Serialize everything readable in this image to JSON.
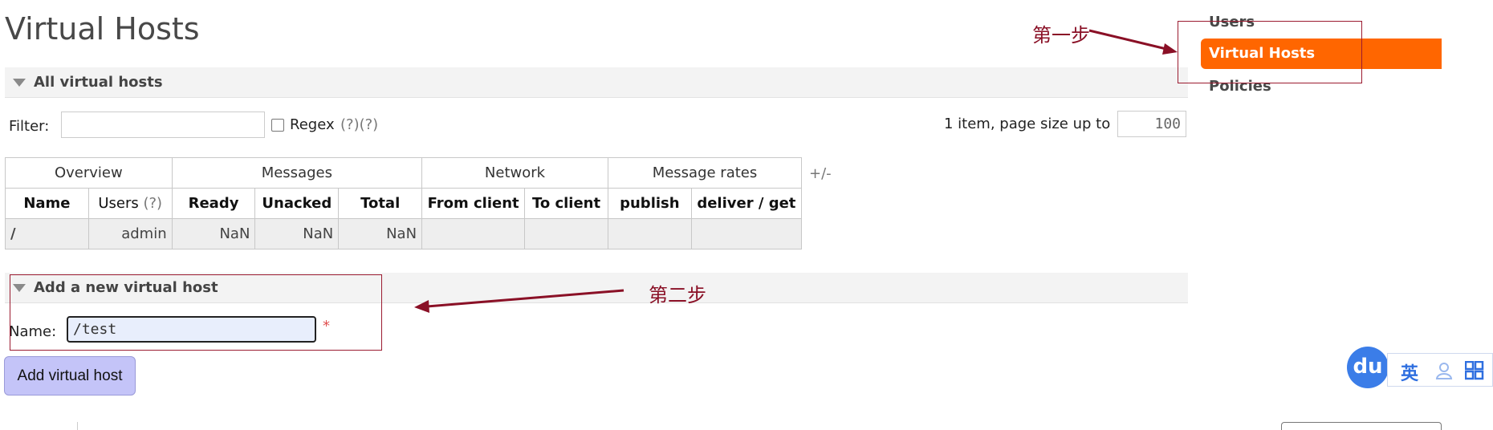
{
  "page": {
    "title": "Virtual Hosts"
  },
  "all_section": {
    "title": "All virtual hosts"
  },
  "filter": {
    "label": "Filter:",
    "value": "",
    "regex_label": "Regex",
    "regex_help": "(?)(?)",
    "items_text": "1 item, page size up to",
    "page_size": "100"
  },
  "table": {
    "groups": [
      "Overview",
      "Messages",
      "Network",
      "Message rates"
    ],
    "toggle": "+/-",
    "columns": {
      "name": "Name",
      "users": "Users",
      "users_help": "(?)",
      "ready": "Ready",
      "unacked": "Unacked",
      "total": "Total",
      "from_client": "From client",
      "to_client": "To client",
      "publish": "publish",
      "deliver_get": "deliver / get"
    },
    "rows": [
      {
        "name": "/",
        "users": "admin",
        "ready": "NaN",
        "unacked": "NaN",
        "total": "NaN",
        "from_client": "",
        "to_client": "",
        "publish": "",
        "deliver_get": ""
      }
    ]
  },
  "sidebar": {
    "items": [
      {
        "label": "Users",
        "active": false
      },
      {
        "label": "Virtual Hosts",
        "active": true
      },
      {
        "label": "Policies",
        "active": false
      }
    ]
  },
  "add_section": {
    "title": "Add a new virtual host",
    "name_label": "Name:",
    "name_value": "/test",
    "required_mark": "*",
    "button_label": "Add virtual host"
  },
  "annotations": {
    "step1": "第一步",
    "step2": "第二步"
  },
  "widget": {
    "logo": "du",
    "lang": "英"
  },
  "colors": {
    "accent": "#ff6600",
    "annotation": "#9b1b30",
    "button": "#c4c4f8",
    "widget_blue": "#3b7de8"
  },
  "icons": {
    "collapse": "triangle-down-icon",
    "user": "user-icon",
    "grid": "grid-icon"
  }
}
